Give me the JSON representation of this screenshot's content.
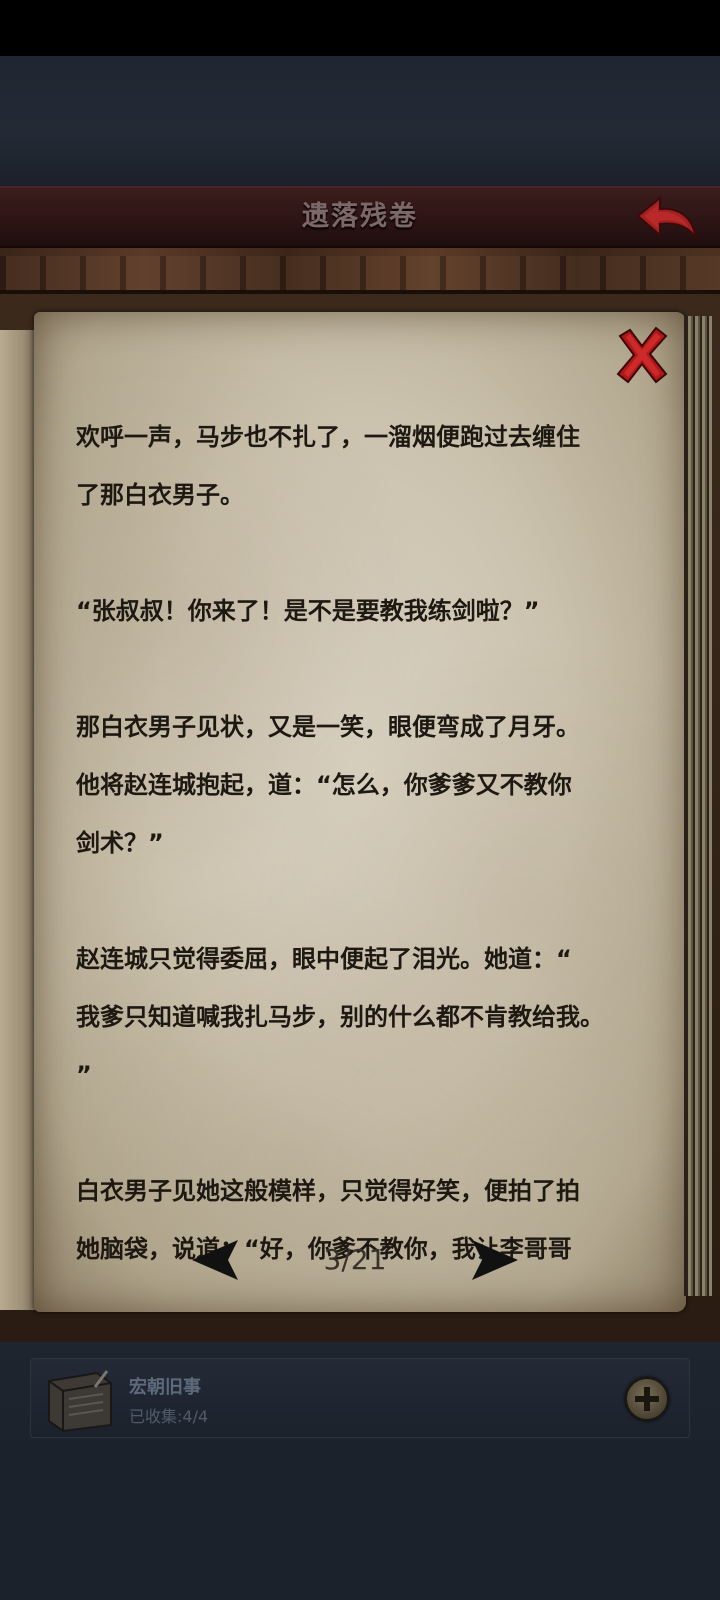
{
  "header": {
    "title": "遗落残卷",
    "back_icon": "back-arrow-icon"
  },
  "page": {
    "close_icon": "close-x-icon",
    "lines": [
      "欢呼一声，马步也不扎了，一溜烟便跑过去缠住",
      "了那白衣男子。",
      "",
      "“张叔叔！你来了！是不是要教我练剑啦？”",
      "",
      "那白衣男子见状，又是一笑，眼便弯成了月牙。",
      "他将赵连城抱起，道：“怎么，你爹爹又不教你",
      "剑术？”",
      "",
      "赵连城只觉得委屈，眼中便起了泪光。她道：“",
      "我爹只知道喊我扎马步，别的什么都不肯教给我。",
      "”",
      "",
      "白衣男子见她这般模样，只觉得好笑，便拍了拍",
      "她脑袋，说道：“好，你爹不教你，我让李哥哥"
    ]
  },
  "pager": {
    "indicator": "3/21",
    "prev_icon": "left-triangle-icon",
    "next_icon": "right-triangle-icon"
  },
  "collection": {
    "title": "宏朝旧事",
    "count": "已收集:4/4",
    "book_icon": "book-icon",
    "add_icon": "plus-icon"
  }
}
